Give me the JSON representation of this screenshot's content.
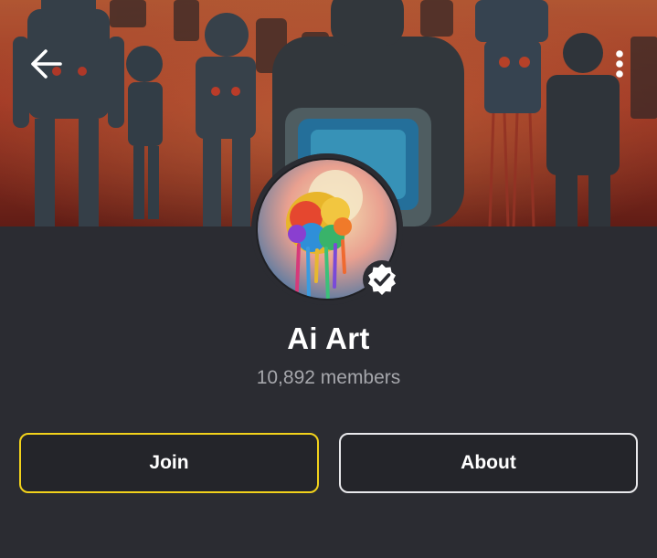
{
  "header": {
    "back_icon": "arrow-left-icon",
    "menu_icon": "more-vertical-icon"
  },
  "community": {
    "name": "Ai Art",
    "members": "10,892 members",
    "verified_icon": "verified-badge-icon"
  },
  "actions": {
    "join_label": "Join",
    "about_label": "About"
  },
  "colors": {
    "background": "#2b2c32",
    "join_border": "#f2d21b",
    "about_border": "#e9e9ec",
    "muted_text": "#a5a6ab"
  }
}
